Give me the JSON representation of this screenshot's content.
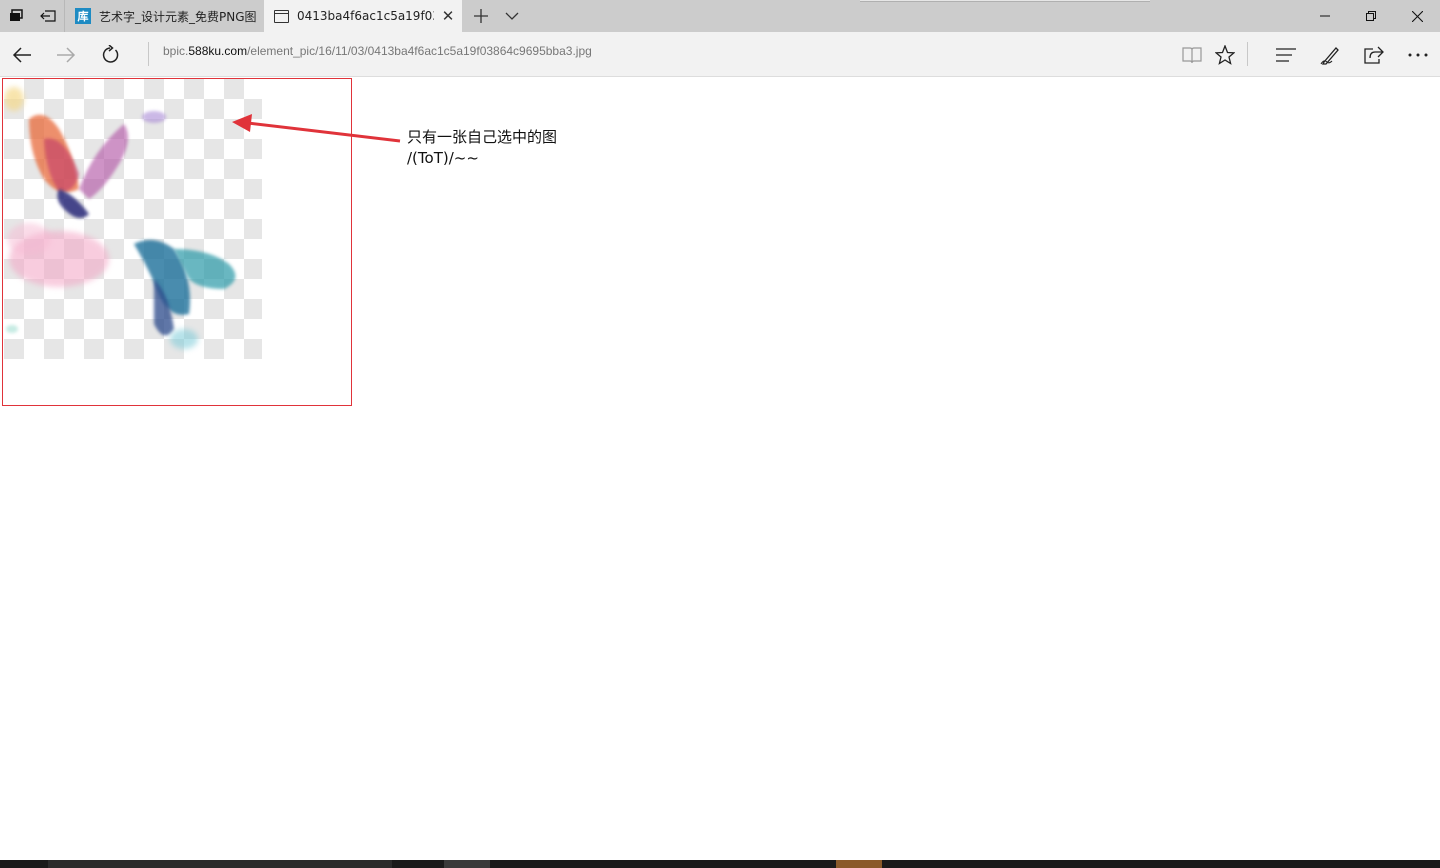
{
  "tabs": [
    {
      "title": "艺术字_设计元素_免费PNG图",
      "favicon": "库",
      "active": false
    },
    {
      "title": "0413ba4f6ac1c5a19f03864c9695bba3.jpg",
      "active": true
    }
  ],
  "address": {
    "prefix": "bpic.",
    "domain": "588ku.com",
    "path": "/element_pic/16/11/03/0413ba4f6ac1c5a19f03864c9695bba3.jpg"
  },
  "annotation": {
    "line1": "只有一张自己选中的图",
    "line2": "/(ToT)/~~"
  },
  "colors": {
    "annotation_red": "#e0333a",
    "tabbar_bg": "#cccccc",
    "toolbar_bg": "#f2f2f2"
  }
}
